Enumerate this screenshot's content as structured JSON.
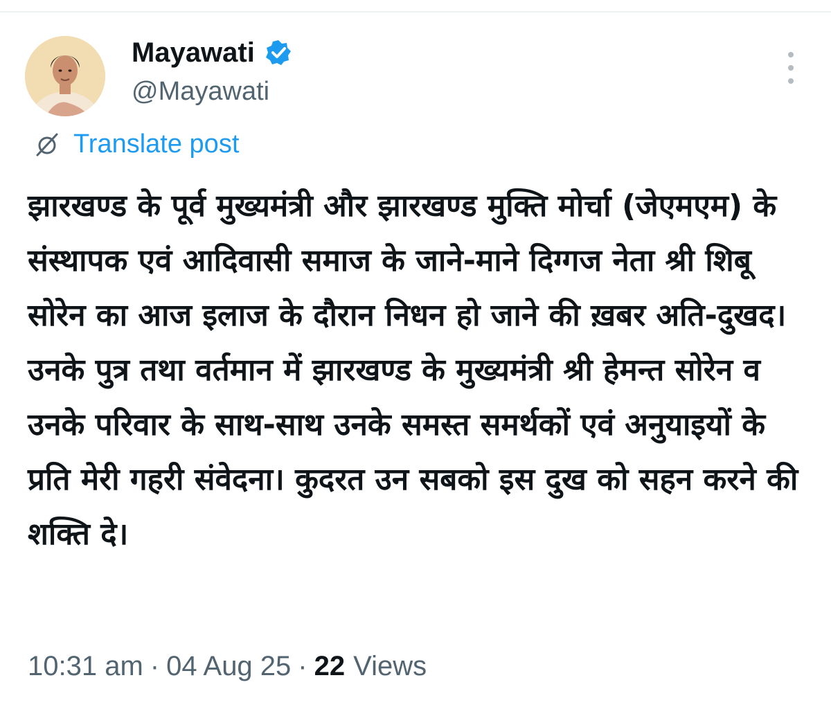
{
  "author": {
    "display_name": "Mayawati",
    "handle": "@Mayawati",
    "verified": true,
    "avatar_icon": "profile-photo"
  },
  "icons": {
    "verified": "verified-badge-icon",
    "translate": "translate-icon",
    "more": "more-options-icon"
  },
  "translate": {
    "label": "Translate post"
  },
  "post": {
    "text": "झारखण्ड के पूर्व मुख्यमंत्री और झारखण्ड मुक्ति मोर्चा (जेएमएम) के संस्थापक एवं आदिवासी समाज के जाने-माने दिग्गज नेता श्री शिबू सोरेन का आज इलाज के दौरान निधन हो जाने की ख़बर अति-दुखद। उनके पुत्र तथा वर्तमान में झारखण्ड के मुख्यमंत्री श्री हेमन्त सोरेन व उनके परिवार के साथ-साथ उनके समस्त समर्थकों एवं अनुयाइयों के प्रति मेरी गहरी संवेदना। कुदरत उन सबको इस दुख को सहन करने की शक्ति दे।"
  },
  "meta": {
    "time": "10:31 am",
    "separator": "·",
    "date": "04 Aug 25",
    "views_count": "22",
    "views_label": "Views"
  },
  "colors": {
    "accent": "#1d9bf0",
    "text": "#0f1419",
    "muted": "#536471",
    "divider": "#eff3f4"
  }
}
